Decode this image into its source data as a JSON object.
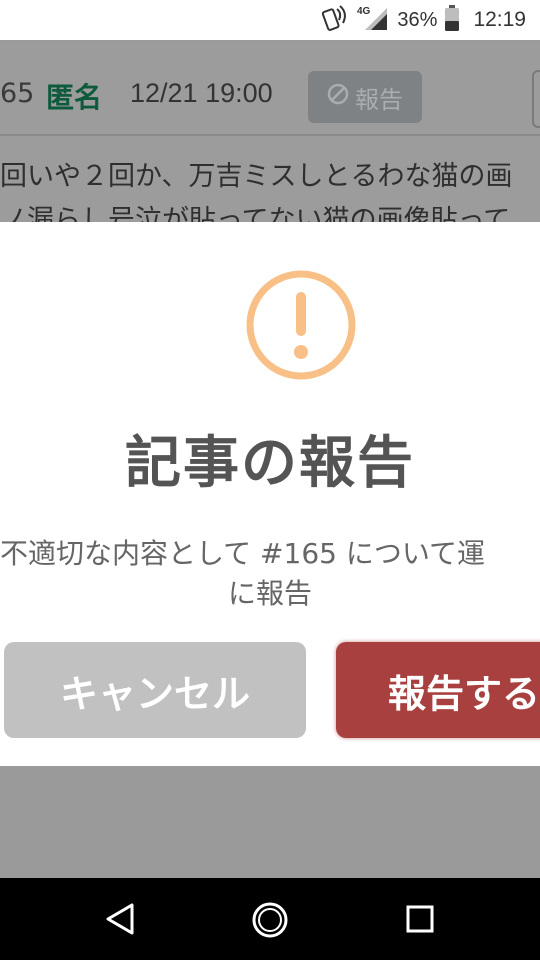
{
  "status_bar": {
    "network": "4G",
    "battery": "36%",
    "time": "12:19"
  },
  "post": {
    "number": "65",
    "author": "匿名",
    "date": "12/21 19:00",
    "report_label": "報告",
    "line1": "回いや２回か、万吉ミスしとるわな猫の画",
    "line2": "ノ漏らし号泣が貼ってない猫の画像貼って"
  },
  "modal": {
    "title": "記事の報告",
    "message_line1": "不適切な内容として #165 について運",
    "message_line2": "に報告",
    "cancel_label": "キャンセル",
    "report_label": "報告する"
  },
  "colors": {
    "warning": "#f8bf86",
    "author": "#0d5a3c",
    "report_button": "#a94040",
    "cancel_button": "#c1c1c1"
  },
  "icons": [
    "nfc-phone-icon",
    "signal-icon",
    "battery-icon",
    "warning-circle-icon",
    "block-icon",
    "back-icon",
    "home-icon",
    "recent-apps-icon"
  ]
}
